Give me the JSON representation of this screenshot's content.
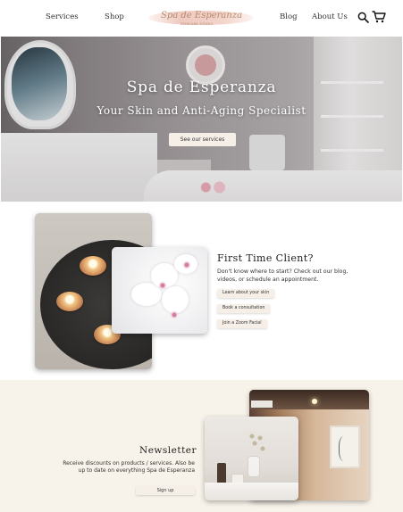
{
  "nav": {
    "services": "Services",
    "shop": "Shop",
    "blog": "Blog",
    "about": "About Us",
    "logo_text": "Spa de Esperanza",
    "logo_tagline": "SKINCARE STUDIO"
  },
  "hero": {
    "title": "Spa de Esperanza",
    "subtitle": "Your Skin and Anti-Aging Specialist",
    "button": "See our services"
  },
  "first_time": {
    "title": "First Time Client?",
    "text": "Don't know where to start? Check out our blog, videos, or schedule an appointment.",
    "buttons": [
      "Learn about your skin",
      "Book a consultation",
      "Join a Zoom Facial"
    ]
  },
  "newsletter": {
    "title": "Newsletter",
    "text": "Receive discounts on products / services. Also be up to date on everything Spa de Esperanza",
    "button": "Sign up"
  },
  "colors": {
    "button_bg": "#f6efe8",
    "newsletter_bg": "#f8f3ea",
    "text": "#222222"
  },
  "icons": [
    "search-icon",
    "cart-icon"
  ]
}
